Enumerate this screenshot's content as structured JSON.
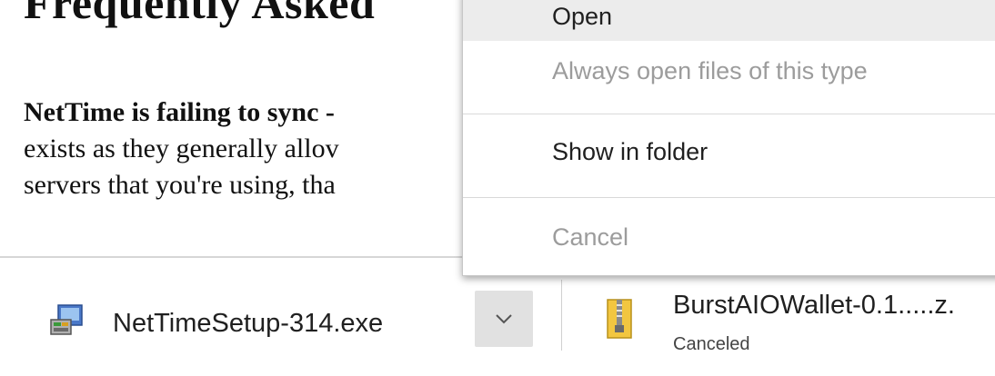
{
  "page": {
    "heading": "Frequently Asked",
    "question_bold": "NetTime is failing to sync -",
    "line2": "exists as they generally allov",
    "line3": "servers that you're using, tha"
  },
  "context_menu": {
    "items": [
      {
        "label": "Open",
        "enabled": true,
        "hovered": true
      },
      {
        "label": "Always open files of this type",
        "enabled": false
      },
      {
        "label": "Show in folder",
        "enabled": true
      },
      {
        "label": "Cancel",
        "enabled": false
      }
    ]
  },
  "download_shelf": {
    "items": [
      {
        "file_name": "NetTimeSetup-314.exe",
        "icon": "installer-icon",
        "status": ""
      },
      {
        "file_name": "BurstAIOWallet-0.1.....z.",
        "icon": "zip-archive-icon",
        "status": "Canceled"
      }
    ]
  }
}
